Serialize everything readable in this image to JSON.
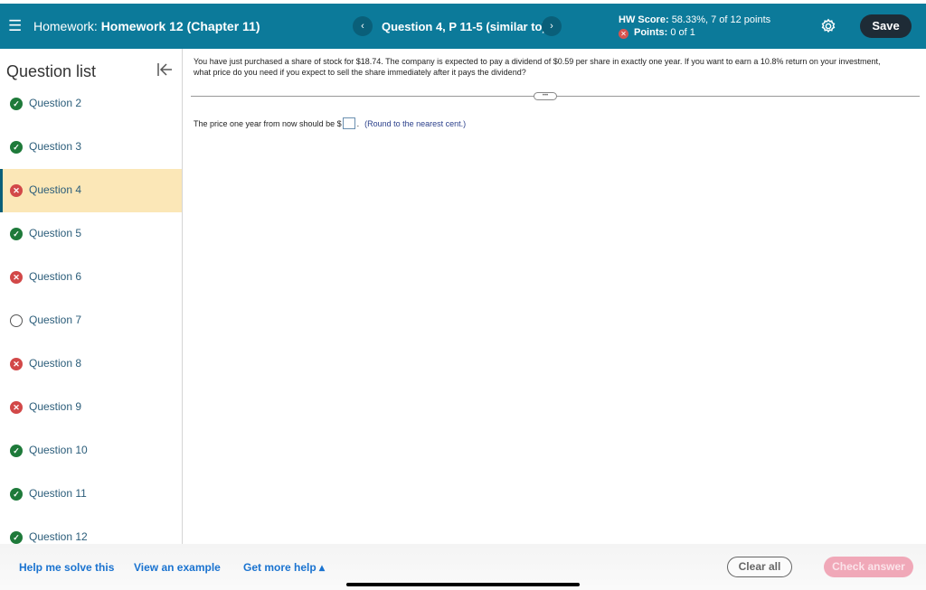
{
  "header": {
    "homework_prefix": "Homework:",
    "homework_name": "Homework 12 (Chapter 11)",
    "question_title": "Question 4, P 11-5 (similar to)",
    "prev_icon": "‹",
    "next_icon": "›",
    "hw_score_label": "HW Score:",
    "hw_score_value": "58.33%, 7 of 12 points",
    "points_label": "Points:",
    "points_value": "0 of 1",
    "save_label": "Save",
    "accent_color": "#0c7a9a"
  },
  "sidebar": {
    "title": "Question list",
    "items": [
      {
        "label": "Question 2",
        "status": "correct"
      },
      {
        "label": "Question 3",
        "status": "correct"
      },
      {
        "label": "Question 4",
        "status": "wrong",
        "active": true
      },
      {
        "label": "Question 5",
        "status": "correct"
      },
      {
        "label": "Question 6",
        "status": "wrong"
      },
      {
        "label": "Question 7",
        "status": "unanswered"
      },
      {
        "label": "Question 8",
        "status": "wrong"
      },
      {
        "label": "Question 9",
        "status": "wrong"
      },
      {
        "label": "Question 10",
        "status": "correct"
      },
      {
        "label": "Question 11",
        "status": "correct"
      },
      {
        "label": "Question 12",
        "status": "correct"
      }
    ]
  },
  "question": {
    "text": "You have just purchased a share of stock for $18.74. The company is expected to pay a dividend of $0.59 per share in exactly one year. If you want to earn a 10.8% return on your investment, what price do you need if you expect to sell the share immediately after it pays the dividend?",
    "expand_label": "•••",
    "answer_prefix": "The price one year from now should be $",
    "answer_value": "",
    "answer_suffix": ".",
    "round_note": "(Round to the nearest cent.)"
  },
  "footer": {
    "help_me_solve": "Help me solve this",
    "view_example": "View an example",
    "get_more_help": "Get more help ▴",
    "clear_all": "Clear all",
    "check_answer": "Check answer"
  }
}
